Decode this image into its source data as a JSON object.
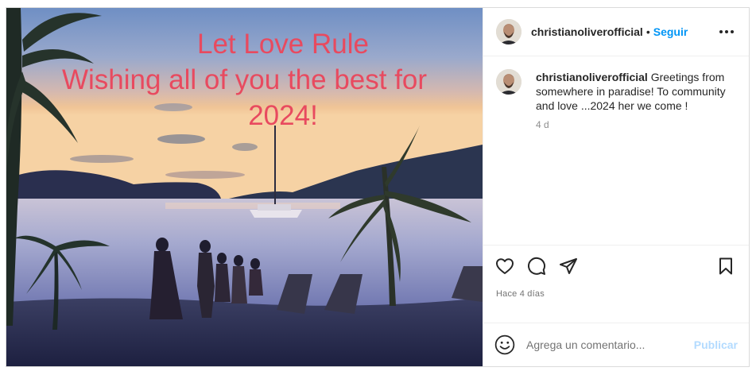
{
  "post": {
    "overlay_lines": [
      "Let Love Rule",
      "Wishing all of you the best for",
      "2024!"
    ],
    "colors": {
      "overlay_text": "#e84a5f",
      "follow": "#0095f6",
      "publish_disabled": "#b3dbff"
    }
  },
  "header": {
    "username": "christianoliverofficial",
    "separator": "•",
    "follow_label": "Seguir",
    "more_icon": "more-horizontal-icon"
  },
  "caption": {
    "username": "christianoliverofficial",
    "text": "Greetings from somewhere in paradise! To community and love ...2024 her we come !",
    "time": "4 d"
  },
  "actions": {
    "icons": [
      "heart-icon",
      "comment-icon",
      "share-icon",
      "bookmark-icon"
    ]
  },
  "meta": {
    "date": "Hace 4 días"
  },
  "comment_box": {
    "placeholder": "Agrega un comentario...",
    "publish_label": "Publicar",
    "emoji_icon": "emoji-icon"
  }
}
